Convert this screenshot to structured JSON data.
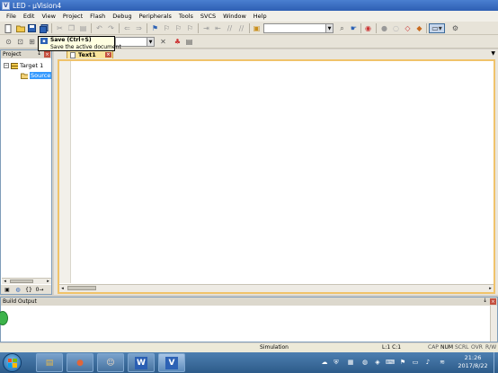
{
  "window": {
    "app_icon_letter": "V",
    "title": "LED  - µVision4"
  },
  "menu": [
    "File",
    "Edit",
    "View",
    "Project",
    "Flash",
    "Debug",
    "Peripherals",
    "Tools",
    "SVCS",
    "Window",
    "Help"
  ],
  "tooltip": {
    "title": "Save (Ctrl+S)",
    "description": "Save the active document"
  },
  "project_panel": {
    "title": "Project",
    "pin_glyph": "↓",
    "close_glyph": "×",
    "tree": {
      "target": {
        "expander": "−",
        "label": "Target 1"
      },
      "group": {
        "label": "Source"
      }
    },
    "tab_glyphs": [
      "▣",
      "◍",
      "{}",
      "0→"
    ]
  },
  "editor": {
    "tab_label": "Text1",
    "tab_close": "×",
    "menu_arrow": "▼"
  },
  "build_output": {
    "title": "Build Output",
    "pin_glyph": "↓",
    "close_glyph": "×"
  },
  "status_bar": {
    "mode": "Simulation",
    "cursor": "L:1 C:1",
    "caps": "CAP",
    "num": "NUM",
    "scroll": "SCRL",
    "overwrite": "OVR",
    "readwrite": "R/W"
  },
  "taskbar": {
    "apps": [
      {
        "name": "explorer",
        "glyph": "▤",
        "color": "#e8b84a"
      },
      {
        "name": "media",
        "glyph": "●",
        "color": "#e0663a"
      },
      {
        "name": "photo",
        "glyph": "☺",
        "color": "#c9a27c"
      },
      {
        "name": "word",
        "glyph": "W",
        "color": "#2b5fb3"
      },
      {
        "name": "uvision",
        "glyph": "V",
        "color": "#2d62b5"
      }
    ],
    "clock_time": "21:26",
    "clock_date": "2017/8/22"
  },
  "colors": {
    "title_bar": "#2e5fb3",
    "editor_border": "#f0c36a",
    "tab_active": "#f9e49c",
    "selection": "#3399ff",
    "taskbar": "#3b6a99"
  }
}
